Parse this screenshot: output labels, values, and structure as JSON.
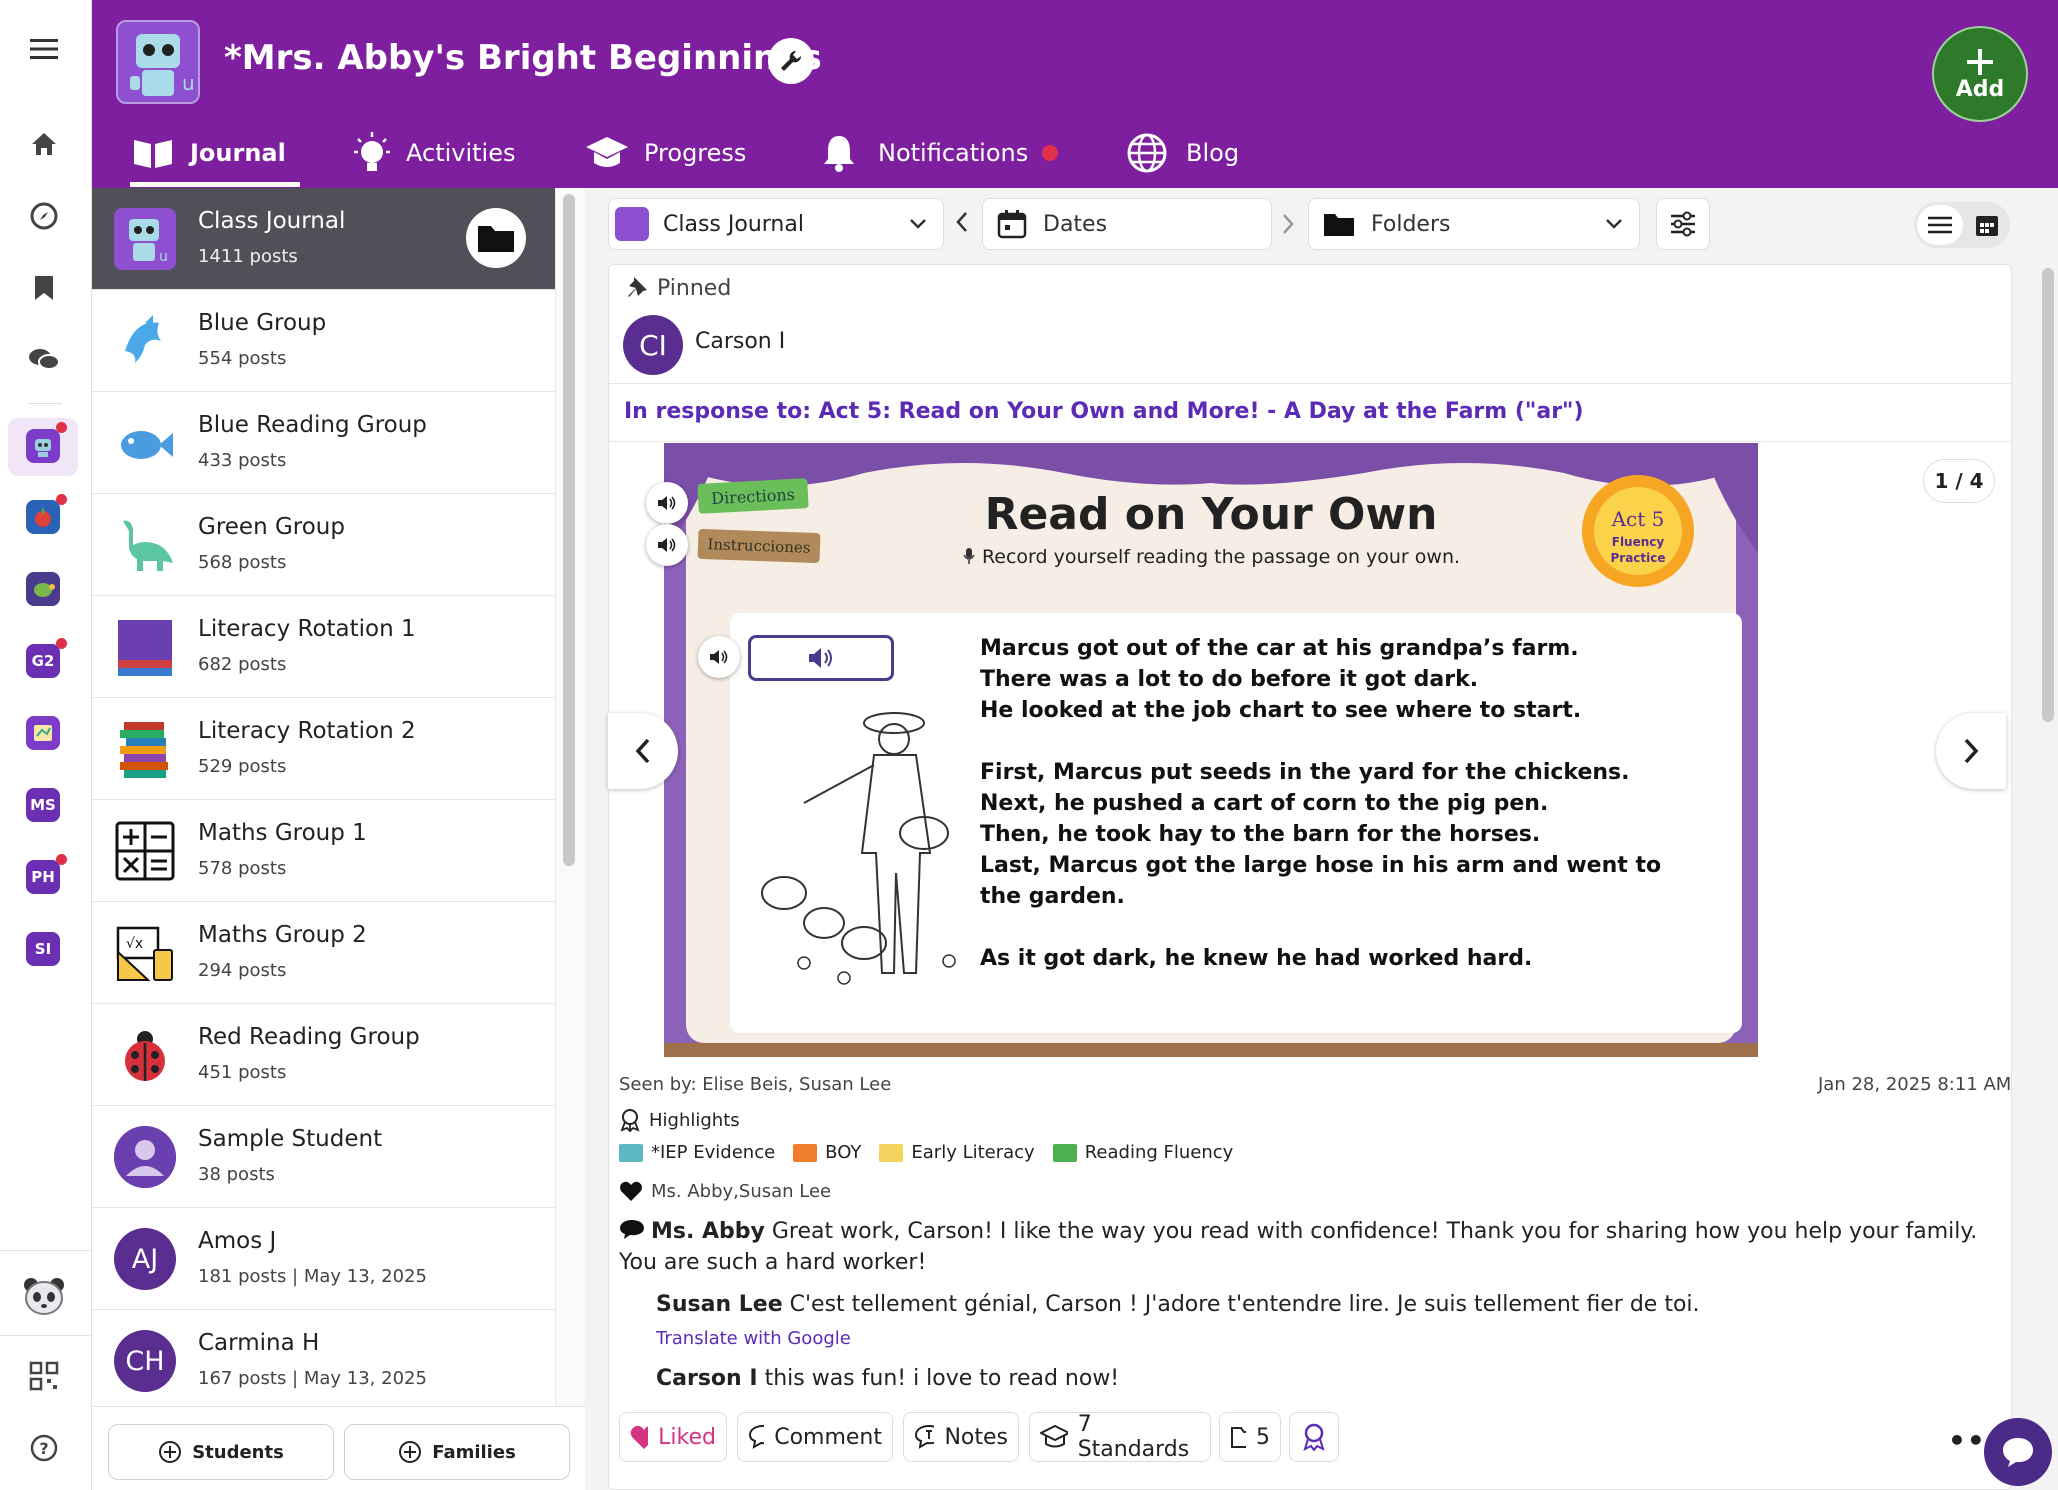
{
  "header": {
    "title": "*Mrs. Abby's Bright Beginnings",
    "add_label": "Add",
    "tabs": [
      {
        "label": "Journal"
      },
      {
        "label": "Activities"
      },
      {
        "label": "Progress"
      },
      {
        "label": "Notifications"
      },
      {
        "label": "Blog"
      }
    ]
  },
  "rail": {
    "badges": [
      "G2",
      "MS",
      "PH",
      "SI"
    ]
  },
  "list": {
    "items": [
      {
        "name": "Class Journal",
        "count": "1411 posts"
      },
      {
        "name": "Blue Group",
        "count": "554 posts"
      },
      {
        "name": "Blue Reading Group",
        "count": "433 posts"
      },
      {
        "name": "Green Group",
        "count": "568 posts"
      },
      {
        "name": "Literacy Rotation 1",
        "count": "682 posts"
      },
      {
        "name": "Literacy Rotation 2",
        "count": "529 posts"
      },
      {
        "name": "Maths Group 1",
        "count": "578 posts"
      },
      {
        "name": "Maths Group 2",
        "count": "294 posts"
      },
      {
        "name": "Red Reading Group",
        "count": "451 posts"
      },
      {
        "name": "Sample Student",
        "count": "38 posts"
      },
      {
        "name": "Amos J",
        "count": "181 posts | May 13, 2025",
        "initials": "AJ"
      },
      {
        "name": "Carmina H",
        "count": "167 posts | May 13, 2025",
        "initials": "CH"
      }
    ],
    "students_label": "Students",
    "families_label": "Families"
  },
  "toolbar": {
    "journal_select": "Class Journal",
    "dates_label": "Dates",
    "folders_label": "Folders"
  },
  "post": {
    "pinned_label": "Pinned",
    "author_initials": "CI",
    "author_name": "Carson I",
    "response_to": "In response to: Act 5: Read on Your Own and More! - A Day at the Farm (\"ar\")",
    "page_indicator": "1 / 4",
    "seen_by": "Seen by: Elise Beis, Susan Lee",
    "timestamp": "Jan 28, 2025 8:11 AM",
    "highlights_label": "Highlights",
    "tags": [
      {
        "label": "*IEP Evidence",
        "color": "#5bb8c4"
      },
      {
        "label": "BOY",
        "color": "#ef7d2c"
      },
      {
        "label": "Early Literacy",
        "color": "#f4d35e"
      },
      {
        "label": "Reading Fluency",
        "color": "#4caf50"
      }
    ],
    "likes": "Ms. Abby,Susan Lee",
    "comments": [
      {
        "author": "Ms. Abby",
        "text": "Great work, Carson! I like the way you read with confidence! Thank you for sharing how you help your family. You are such a hard worker!"
      },
      {
        "author": "Susan Lee",
        "text": "C'est tellement génial, Carson ! J'adore t'entendre lire. Je suis tellement fier de toi.",
        "translate": "Translate with Google"
      },
      {
        "author": "Carson I",
        "text": "this was fun! i love to read now!"
      }
    ],
    "actions": {
      "liked": "Liked",
      "comment": "Comment",
      "notes": "Notes",
      "standards": "7 Standards",
      "folders_count": "5"
    }
  },
  "slide": {
    "title": "Read on Your Own",
    "subtitle": "Record yourself reading the passage on your own.",
    "directions": "Directions",
    "instrucciones": "Instrucciones",
    "badge_line1": "Act 5",
    "badge_line2": "Fluency",
    "badge_line3": "Practice",
    "passage": [
      "Marcus got out of the car at his grandpa’s farm.",
      "There was a lot to do before it got dark.",
      "He looked at the job chart to see where to start.",
      "",
      "First, Marcus put seeds in the yard for the chickens.",
      "Next, he pushed a cart of corn to the pig pen.",
      "Then, he took hay to the barn for the horses.",
      "Last, Marcus got the large hose in his arm and went to",
      "the garden.",
      "",
      "As it got dark, he knew he had worked hard."
    ]
  },
  "colors": {
    "header": "#7d1f9e",
    "accent": "#5a2d91",
    "link": "#5b2bb5",
    "liked": "#d63384",
    "notif_dot": "#e0304a"
  }
}
